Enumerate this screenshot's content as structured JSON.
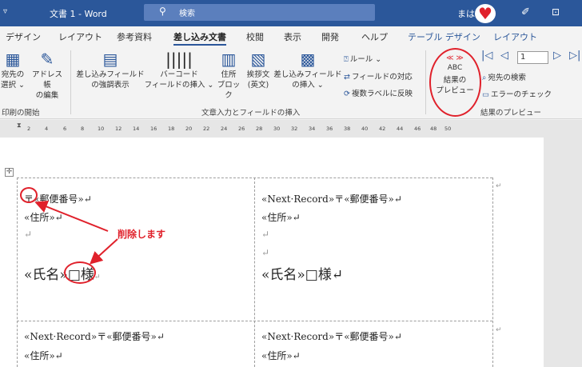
{
  "titlebar": {
    "qa": "▿",
    "title": "文書 1  -  Word",
    "search_icon": "search-icon",
    "search_placeholder": "検索",
    "user": "まは",
    "pen_icon": "pen-icon",
    "window_icon": "window-icon"
  },
  "tabs": [
    "デザイン",
    "レイアウト",
    "参考資料",
    "差し込み文書",
    "校閲",
    "表示",
    "開発",
    "ヘルプ",
    "テーブル デザイン",
    "レイアウト"
  ],
  "ribbon": {
    "group1": {
      "btn_recipients": "宛先の\n選択 ⌄",
      "btn_addressbook": "アドレス帳\nの編集",
      "label": "印刷の開始"
    },
    "group2": {
      "btn_highlight": "差し込みフィールド\nの強調表示",
      "btn_barcode": "バーコード\nフィールドの挿入 ⌄",
      "btn_address": "住所\nブロック",
      "btn_greeting": "挨拶文\n(英文)",
      "btn_insert": "差し込みフィールド\nの挿入 ⌄",
      "rule": "ルール ⌄",
      "match": "フィールドの対応",
      "update": "複数ラベルに反映",
      "label": "文章入力とフィールドの挿入"
    },
    "group3": {
      "preview_icon_top": "≪ ≫",
      "preview_icon_abc": "ABC",
      "btn_preview": "結果の\nプレビュー",
      "record": "1",
      "find": "宛先の検索",
      "check": "エラーのチェック",
      "label": "結果のプレビュー"
    }
  },
  "ruler": [
    "2",
    "4",
    "6",
    "8",
    "10",
    "12",
    "14",
    "16",
    "18",
    "20",
    "22",
    "24",
    "26",
    "28",
    "30",
    "32",
    "34",
    "36",
    "38",
    "40",
    "42",
    "44",
    "46",
    "48",
    "50"
  ],
  "labels": {
    "cell1": {
      "line1_mark": "〒",
      "line1_rest": "«郵便番号»↵",
      "line2": "«住所»↵",
      "line3": "↵",
      "name": "«氏名»",
      "honorific": "□様",
      "end": "↵"
    },
    "cell2": {
      "line1": "«Next·Record»〒«郵便番号»↵",
      "line2": "«住所»↵",
      "line3": "↵",
      "line4": "↵",
      "name": "«氏名»□様↵"
    },
    "cell3": {
      "line1": "«Next·Record»〒«郵便番号»↵",
      "line2": "«住所»↵"
    },
    "cell4": {
      "line1": "«Next·Record»〒«郵便番号»↵",
      "line2": "«住所»↵"
    }
  },
  "annotation": "削除します",
  "colors": {
    "title_blue": "#2b579a",
    "annotation_red": "#e0212b"
  }
}
